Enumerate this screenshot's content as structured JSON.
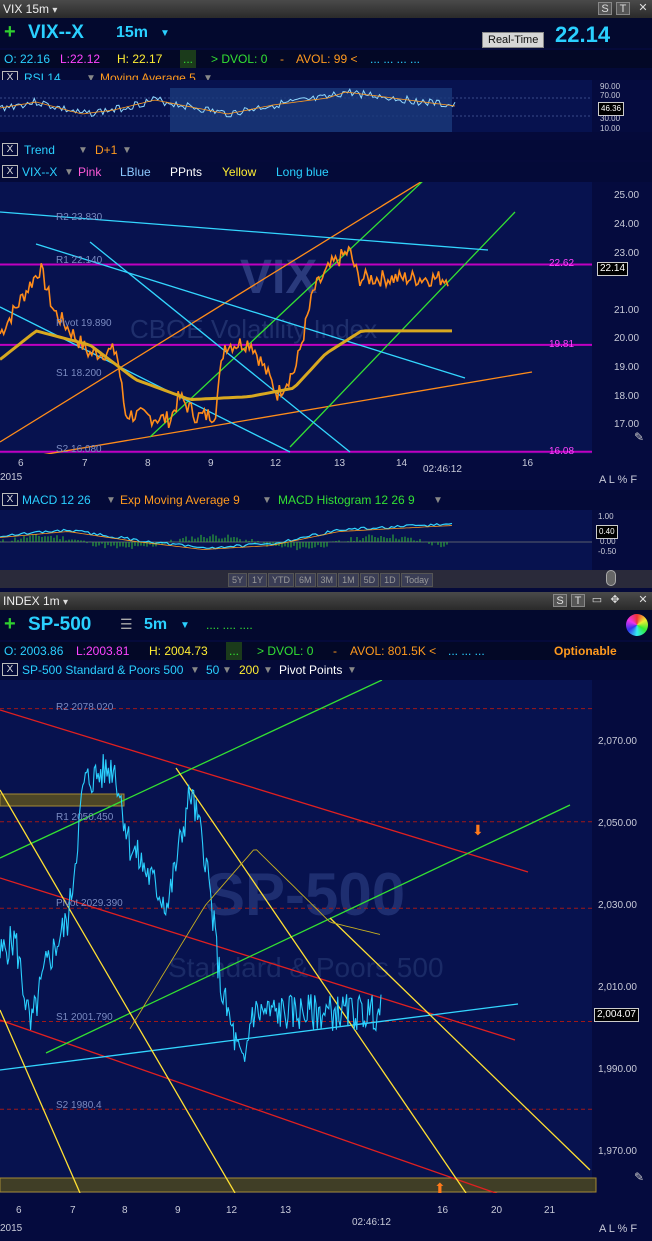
{
  "top": {
    "window_title": "VIX 15m",
    "symbol": "VIX--X",
    "timeframe": "15m",
    "realtime_label": "Real-Time",
    "last_price": "22.14",
    "quote": {
      "open": "O: 22.16",
      "low": "L:22.12",
      "high": "H: 22.17",
      "more": "...",
      "dvol": "> DVOL: 0",
      "sep": "-",
      "avol": "AVOL: 99 <",
      "dots": "...  ...  ...  ..."
    },
    "rsi_bar": {
      "rsi": "RSI 14",
      "ma": "Moving Average 5"
    },
    "rsi_scale": [
      "90.00",
      "70.00",
      "46.36",
      "30.00",
      "10.00"
    ],
    "trend_bar": {
      "trend": "Trend",
      "d1": "D+1"
    },
    "legend": {
      "sym": "VIX--X",
      "pink": "Pink",
      "lblue": "LBlue",
      "ppnts": "PPnts",
      "yellow": "Yellow",
      "longblue": "Long blue"
    },
    "price_scale": [
      "25.00",
      "24.00",
      "23.00",
      "22.62",
      "21.00",
      "20.00",
      "19.81",
      "19.00",
      "18.00",
      "17.00",
      "16.08"
    ],
    "last_tag": "22.14",
    "pivot_labels": {
      "r2": "R2 23.830",
      "r1": "R1 22.140",
      "pivot": "Pivot 19.890",
      "s1": "S1 18.200",
      "s2": "S2 16.080"
    },
    "watermark": "VIX",
    "watermark2": "CBOE Volatility Index",
    "x_labels": [
      "6",
      "7",
      "8",
      "9",
      "12",
      "13",
      "14",
      "02:46:12",
      "16"
    ],
    "year": "2015",
    "right_controls": "A L % F",
    "macd_bar": {
      "macd": "MACD 12 26",
      "ema": "Exp Moving Average 9",
      "hist": "MACD Histogram 12 26 9"
    },
    "macd_scale": [
      "1.00",
      "0.40",
      "0.00",
      "-0.50"
    ],
    "nav": [
      "5Y",
      "1Y",
      "YTD",
      "6M",
      "3M",
      "1M",
      "5D",
      "1D",
      "Today"
    ]
  },
  "bottom": {
    "window_title": "INDEX 1m",
    "symbol": "SP-500",
    "timeframe": "5m",
    "quote": {
      "open": "O: 2003.86",
      "low": "L:2003.81",
      "high": "H: 2004.73",
      "more": "...",
      "dvol": "> DVOL: 0",
      "sep": "-",
      "avol": "AVOL: 801.5K <",
      "dots": "...  ...  ...",
      "optionable": "Optionable"
    },
    "legend": {
      "name": "SP-500 Standard & Poors 500",
      "ma50": "50",
      "ma200": "200",
      "pivots": "Pivot Points"
    },
    "price_scale": [
      "2,070.00",
      "2,050.00",
      "2,030.00",
      "2,010.00",
      "1,990.00",
      "1,970.00"
    ],
    "last_tag": "2,004.07",
    "pivot_labels": {
      "r2": "R2 2078.020",
      "r1": "R1 2050.450",
      "pivot": "Pivot 2029.390",
      "s1": "S1 2001.790",
      "s2": "S2 1980.4"
    },
    "watermark": "SP-500",
    "watermark2": "Standard & Poors 500",
    "x_labels": [
      "6",
      "7",
      "8",
      "9",
      "12",
      "13",
      "02:46:12",
      "16",
      "20",
      "21"
    ],
    "year": "2015",
    "right_controls": "A L % F"
  },
  "chart_data": [
    {
      "type": "line",
      "title": "VIX--X 15m",
      "xlabel": "",
      "ylabel": "",
      "ylim": [
        16.0,
        25.5
      ],
      "x": [
        "6",
        "7",
        "8",
        "9",
        "12",
        "13",
        "14",
        "16"
      ],
      "series": [
        {
          "name": "VIX--X",
          "values": [
            20.2,
            22.4,
            19.4,
            17.3,
            17.6,
            18.3,
            21.6,
            22.14
          ]
        },
        {
          "name": "Moving Average",
          "values": [
            19.3,
            20.3,
            19.6,
            18.4,
            17.9,
            18.2,
            19.5,
            20.3
          ]
        }
      ],
      "horizontal_lines": {
        "22.62": "magenta",
        "19.81": "magenta",
        "16.08": "magenta"
      },
      "last": 22.14
    },
    {
      "type": "line",
      "title": "SP-500 5m",
      "xlabel": "",
      "ylabel": "",
      "ylim": [
        1960,
        2085
      ],
      "x": [
        "6",
        "7",
        "8",
        "9",
        "12",
        "13",
        "16",
        "20",
        "21"
      ],
      "series": [
        {
          "name": "SP-500",
          "values": [
            2022,
            1994,
            2032,
            2064,
            2034,
            2058,
            2004.07
          ]
        }
      ],
      "last": 2004.07
    }
  ],
  "colors": {
    "bg": "#07124f",
    "accent": "#2ad0ff",
    "plus": "#2fd02f",
    "magenta": "#c000c0",
    "orange": "#ff8c1a",
    "green": "#33e033",
    "cyan": "#33d6ff",
    "yellow": "#ffe033",
    "red": "#e02020"
  }
}
